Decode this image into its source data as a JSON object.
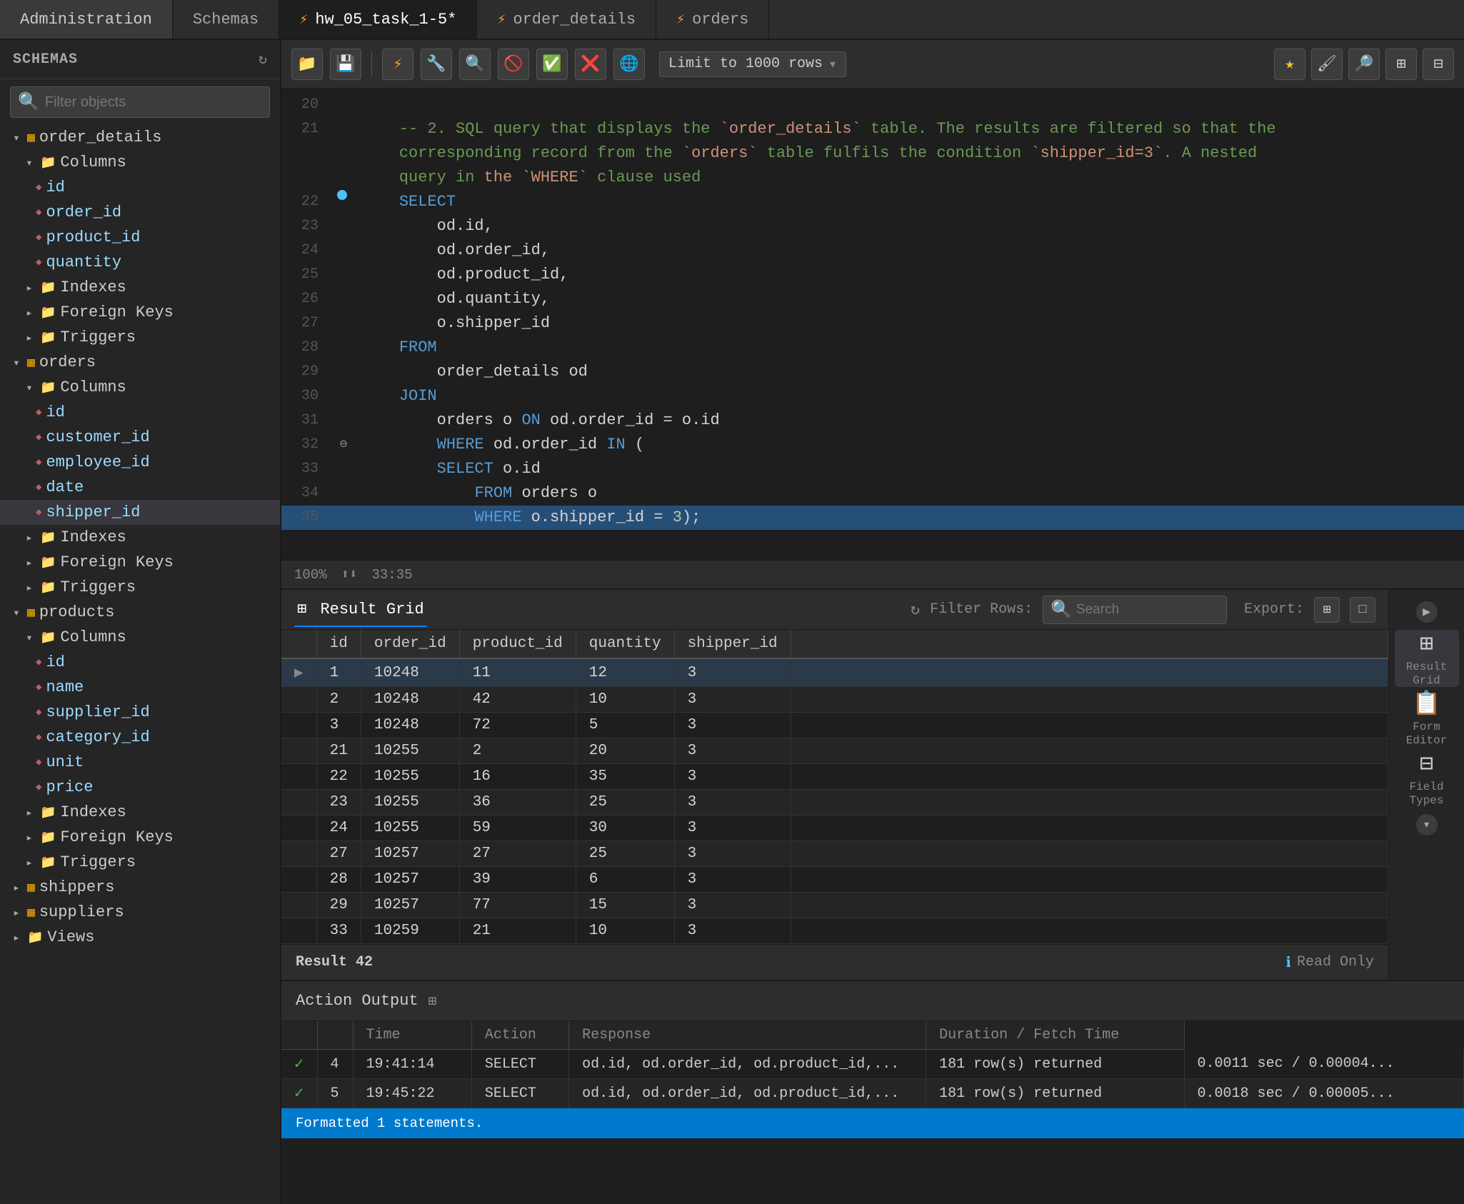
{
  "tabs": [
    {
      "id": "admin",
      "label": "Administration",
      "active": false,
      "icon": ""
    },
    {
      "id": "schemas",
      "label": "Schemas",
      "active": false,
      "icon": ""
    },
    {
      "id": "hw05",
      "label": "hw_05_task_1-5*",
      "active": true,
      "icon": "⚡"
    },
    {
      "id": "order_details",
      "label": "order_details",
      "active": false,
      "icon": "⚡"
    },
    {
      "id": "orders",
      "label": "orders",
      "active": false,
      "icon": "⚡"
    }
  ],
  "sidebar": {
    "header": "SCHEMAS",
    "search_placeholder": "Filter objects",
    "tree": [
      {
        "id": "order_details_table",
        "level": 1,
        "expanded": true,
        "icon": "table",
        "label": "order_details"
      },
      {
        "id": "order_details_columns",
        "level": 2,
        "expanded": true,
        "icon": "folder",
        "label": "Columns"
      },
      {
        "id": "od_id",
        "level": 3,
        "icon": "col",
        "label": "id"
      },
      {
        "id": "od_order_id",
        "level": 3,
        "icon": "col",
        "label": "order_id"
      },
      {
        "id": "od_product_id",
        "level": 3,
        "icon": "col",
        "label": "product_id"
      },
      {
        "id": "od_quantity",
        "level": 3,
        "icon": "col",
        "label": "quantity"
      },
      {
        "id": "od_indexes",
        "level": 2,
        "expanded": false,
        "icon": "folder",
        "label": "Indexes"
      },
      {
        "id": "od_foreign_keys",
        "level": 2,
        "expanded": false,
        "icon": "folder",
        "label": "Foreign Keys"
      },
      {
        "id": "od_triggers",
        "level": 2,
        "expanded": false,
        "icon": "folder",
        "label": "Triggers"
      },
      {
        "id": "orders_table",
        "level": 1,
        "expanded": true,
        "icon": "table",
        "label": "orders"
      },
      {
        "id": "orders_columns",
        "level": 2,
        "expanded": true,
        "icon": "folder",
        "label": "Columns"
      },
      {
        "id": "o_id",
        "level": 3,
        "icon": "col",
        "label": "id"
      },
      {
        "id": "o_customer_id",
        "level": 3,
        "icon": "col",
        "label": "customer_id"
      },
      {
        "id": "o_employee_id",
        "level": 3,
        "icon": "col",
        "label": "employee_id"
      },
      {
        "id": "o_date",
        "level": 3,
        "icon": "col",
        "label": "date"
      },
      {
        "id": "o_shipper_id",
        "level": 3,
        "icon": "col",
        "label": "shipper_id",
        "selected": true
      },
      {
        "id": "o_indexes",
        "level": 2,
        "expanded": false,
        "icon": "folder",
        "label": "Indexes"
      },
      {
        "id": "o_foreign_keys",
        "level": 2,
        "expanded": false,
        "icon": "folder",
        "label": "Foreign Keys"
      },
      {
        "id": "o_triggers",
        "level": 2,
        "expanded": false,
        "icon": "folder",
        "label": "Triggers"
      },
      {
        "id": "products_table",
        "level": 1,
        "expanded": true,
        "icon": "table",
        "label": "products"
      },
      {
        "id": "products_columns",
        "level": 2,
        "expanded": true,
        "icon": "folder",
        "label": "Columns"
      },
      {
        "id": "p_id",
        "level": 3,
        "icon": "col",
        "label": "id"
      },
      {
        "id": "p_name",
        "level": 3,
        "icon": "col",
        "label": "name"
      },
      {
        "id": "p_supplier_id",
        "level": 3,
        "icon": "col",
        "label": "supplier_id"
      },
      {
        "id": "p_category_id",
        "level": 3,
        "icon": "col",
        "label": "category_id"
      },
      {
        "id": "p_unit",
        "level": 3,
        "icon": "col",
        "label": "unit"
      },
      {
        "id": "p_price",
        "level": 3,
        "icon": "col",
        "label": "price"
      },
      {
        "id": "p_indexes",
        "level": 2,
        "expanded": false,
        "icon": "folder",
        "label": "Indexes"
      },
      {
        "id": "p_foreign_keys",
        "level": 2,
        "expanded": false,
        "icon": "folder",
        "label": "Foreign Keys"
      },
      {
        "id": "p_triggers",
        "level": 2,
        "expanded": false,
        "icon": "folder",
        "label": "Triggers"
      },
      {
        "id": "shippers_table",
        "level": 1,
        "expanded": false,
        "icon": "table",
        "label": "shippers"
      },
      {
        "id": "suppliers_table",
        "level": 1,
        "expanded": false,
        "icon": "table",
        "label": "suppliers"
      },
      {
        "id": "views_item",
        "level": 0,
        "expanded": false,
        "icon": "folder",
        "label": "Views"
      }
    ]
  },
  "toolbar": {
    "limit_label": "Limit to 1000 rows",
    "buttons": [
      "📁",
      "💾",
      "⚡",
      "🔧",
      "🔍",
      "🚫",
      "✅",
      "❌",
      "🌐"
    ]
  },
  "editor": {
    "zoom": "100%",
    "cursor": "33:35",
    "lines": [
      {
        "num": 20,
        "content": "",
        "type": "normal"
      },
      {
        "num": 21,
        "content": "    -- 2. SQL query that displays the `order_details` table. The results are filtered so that the",
        "type": "comment"
      },
      {
        "num": "",
        "content": "    corresponding record from the `orders` table fulfils the condition `shipper_id=3`. A nested",
        "type": "comment"
      },
      {
        "num": "",
        "content": "    query in the `WHERE` clause used",
        "type": "comment"
      },
      {
        "num": 22,
        "content": "    SELECT",
        "type": "keyword",
        "dot": true
      },
      {
        "num": 23,
        "content": "        od.id,",
        "type": "normal"
      },
      {
        "num": 24,
        "content": "        od.order_id,",
        "type": "normal"
      },
      {
        "num": 25,
        "content": "        od.product_id,",
        "type": "normal"
      },
      {
        "num": 26,
        "content": "        od.quantity,",
        "type": "normal"
      },
      {
        "num": 27,
        "content": "        o.shipper_id",
        "type": "normal"
      },
      {
        "num": 28,
        "content": "    FROM",
        "type": "keyword"
      },
      {
        "num": 29,
        "content": "        order_details od",
        "type": "normal"
      },
      {
        "num": 30,
        "content": "    JOIN",
        "type": "keyword"
      },
      {
        "num": 31,
        "content": "        orders o ON od.order_id = o.id",
        "type": "normal"
      },
      {
        "num": 32,
        "content": "        WHERE od.order_id IN (",
        "type": "where_in",
        "collapse": true
      },
      {
        "num": 33,
        "content": "        SELECT o.id",
        "type": "normal"
      },
      {
        "num": 34,
        "content": "            FROM orders o",
        "type": "normal"
      },
      {
        "num": 35,
        "content": "            WHERE o.shipper_id = 3);",
        "type": "normal",
        "active": true
      }
    ]
  },
  "result_grid": {
    "tab_label": "Result Grid",
    "filter_label": "Filter Rows:",
    "filter_placeholder": "Search",
    "export_label": "Export:",
    "columns": [
      "id",
      "order_id",
      "product_id",
      "quantity",
      "shipper_id"
    ],
    "rows": [
      [
        "1",
        "10248",
        "11",
        "12",
        "3"
      ],
      [
        "2",
        "10248",
        "42",
        "10",
        "3"
      ],
      [
        "3",
        "10248",
        "72",
        "5",
        "3"
      ],
      [
        "21",
        "10255",
        "2",
        "20",
        "3"
      ],
      [
        "22",
        "10255",
        "16",
        "35",
        "3"
      ],
      [
        "23",
        "10255",
        "36",
        "25",
        "3"
      ],
      [
        "24",
        "10255",
        "59",
        "30",
        "3"
      ],
      [
        "27",
        "10257",
        "27",
        "25",
        "3"
      ],
      [
        "28",
        "10257",
        "39",
        "6",
        "3"
      ],
      [
        "29",
        "10257",
        "77",
        "15",
        "3"
      ],
      [
        "33",
        "10259",
        "21",
        "10",
        "3"
      ]
    ],
    "result_count": "Result 42",
    "read_only": "Read Only"
  },
  "side_panel": {
    "result_grid_label": "Result\nGrid",
    "form_editor_label": "Form\nEditor",
    "field_types_label": "Field\nTypes",
    "expand_arrow": "▶"
  },
  "action_output": {
    "title": "Action Output",
    "columns": [
      "",
      "Time",
      "Action",
      "Response",
      "Duration / Fetch Time"
    ],
    "rows": [
      {
        "status": "✓",
        "num": "4",
        "time": "19:41:14",
        "action": "SELECT",
        "detail": "od.id,  od.order_id,  od.product_id,...",
        "response": "181 row(s) returned",
        "duration": "0.0011 sec / 0.00004..."
      },
      {
        "status": "✓",
        "num": "5",
        "time": "19:45:22",
        "action": "SELECT",
        "detail": "od.id,  od.order_id,  od.product_id,...",
        "response": "181 row(s) returned",
        "duration": "0.0018 sec / 0.00005..."
      }
    ]
  },
  "status_bar": {
    "message": "Formatted 1 statements."
  }
}
